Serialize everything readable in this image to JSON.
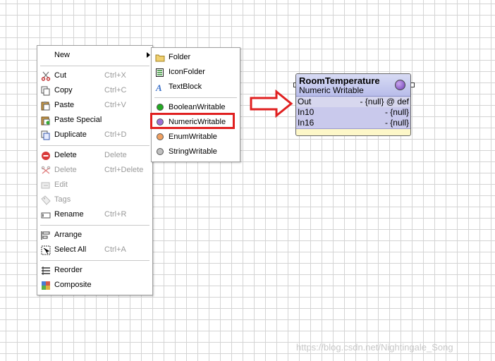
{
  "context_menu": {
    "items": [
      {
        "label": "New",
        "shortcut": "",
        "icon": "new-icon",
        "disabled": false,
        "submenu": true
      },
      {
        "label": "Cut",
        "shortcut": "Ctrl+X",
        "icon": "scissors-icon",
        "disabled": false
      },
      {
        "label": "Copy",
        "shortcut": "Ctrl+C",
        "icon": "copy-icon",
        "disabled": false
      },
      {
        "label": "Paste",
        "shortcut": "Ctrl+V",
        "icon": "paste-icon",
        "disabled": false
      },
      {
        "label": "Paste Special",
        "shortcut": "",
        "icon": "paste-special-icon",
        "disabled": false
      },
      {
        "label": "Duplicate",
        "shortcut": "Ctrl+D",
        "icon": "duplicate-icon",
        "disabled": false
      },
      {
        "label": "Delete",
        "shortcut": "Delete",
        "icon": "delete-icon",
        "disabled": false
      },
      {
        "label": "Delete",
        "shortcut": "Ctrl+Delete",
        "icon": "delete-links-icon",
        "disabled": true
      },
      {
        "label": "Edit",
        "shortcut": "",
        "icon": "edit-icon",
        "disabled": true
      },
      {
        "label": "Tags",
        "shortcut": "",
        "icon": "tags-icon",
        "disabled": true
      },
      {
        "label": "Rename",
        "shortcut": "Ctrl+R",
        "icon": "rename-icon",
        "disabled": false
      },
      {
        "label": "Arrange",
        "shortcut": "",
        "icon": "arrange-icon",
        "disabled": false
      },
      {
        "label": "Select All",
        "shortcut": "Ctrl+A",
        "icon": "select-all-icon",
        "disabled": false
      },
      {
        "label": "Reorder",
        "shortcut": "",
        "icon": "reorder-icon",
        "disabled": false
      },
      {
        "label": "Composite",
        "shortcut": "",
        "icon": "composite-icon",
        "disabled": false
      }
    ]
  },
  "submenu": {
    "items": [
      {
        "label": "Folder",
        "icon": "folder-icon"
      },
      {
        "label": "IconFolder",
        "icon": "icon-folder-icon"
      },
      {
        "label": "TextBlock",
        "icon": "text-block-icon"
      },
      {
        "label": "BooleanWritable",
        "icon": "green-circle-icon",
        "color": "#22aa22"
      },
      {
        "label": "NumericWritable",
        "icon": "purple-circle-icon",
        "color": "#9b6fd6"
      },
      {
        "label": "EnumWritable",
        "icon": "orange-circle-icon",
        "color": "#f0a060"
      },
      {
        "label": "StringWritable",
        "icon": "gray-circle-icon",
        "color": "#c0c0c0"
      }
    ]
  },
  "node": {
    "title": "RoomTemperature",
    "subtitle": "Numeric Writable",
    "slots": [
      {
        "name": "Out",
        "value": "- {null} @ def"
      },
      {
        "name": "In10",
        "value": "- {null}"
      },
      {
        "name": "In16",
        "value": "- {null}"
      }
    ]
  },
  "watermark": "https://blog.csdn.net/Nightingale_Song"
}
